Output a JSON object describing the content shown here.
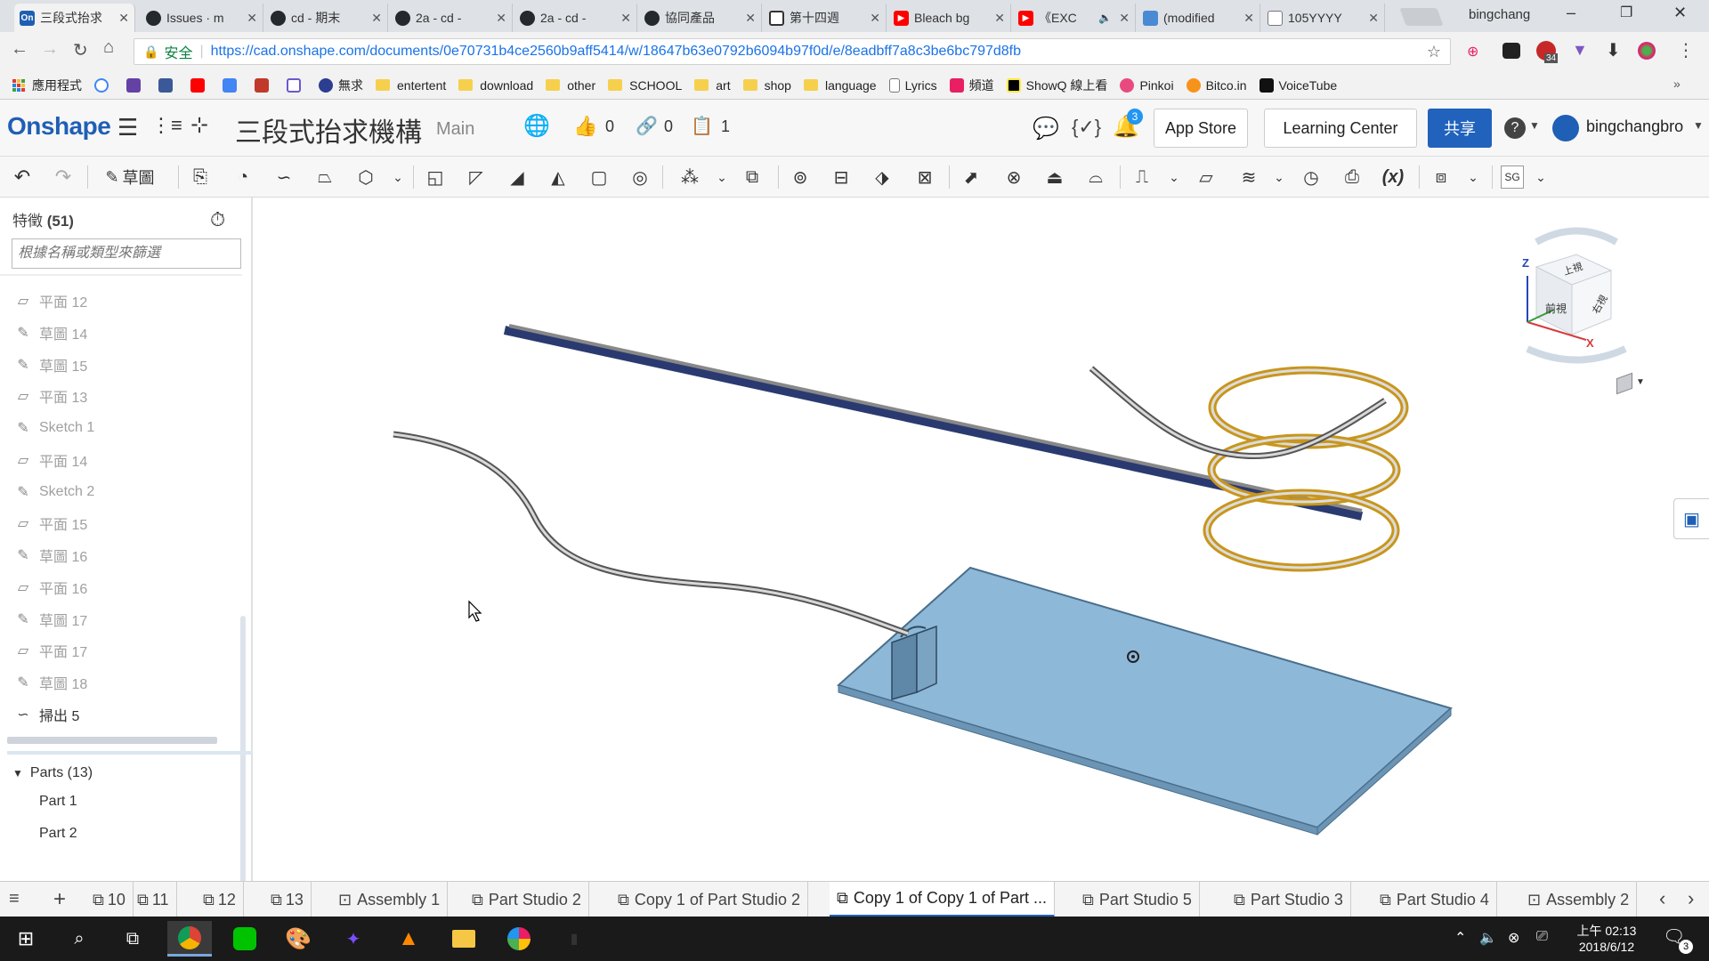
{
  "browser": {
    "tabs": [
      {
        "title": "三段式抬求",
        "active": true,
        "icon": "onshape-favicon"
      },
      {
        "title": "Issues · m",
        "icon": "github-icon"
      },
      {
        "title": "cd - 期末",
        "icon": "github-icon"
      },
      {
        "title": "2a - cd - ",
        "icon": "github-icon"
      },
      {
        "title": "2a - cd - ",
        "icon": "github-icon"
      },
      {
        "title": "協同產品",
        "icon": "github-icon"
      },
      {
        "title": "第十四週",
        "icon": "book-icon"
      },
      {
        "title": "Bleach bg",
        "icon": "youtube-icon"
      },
      {
        "title": "《EXC",
        "icon": "youtube-icon"
      },
      {
        "title": "(modified",
        "icon": "layers-icon"
      },
      {
        "title": "105YYYY",
        "icon": "page-icon"
      }
    ],
    "profile_name": "bingchang",
    "security_label": "安全",
    "url": "https://cad.onshape.com/documents/0e70731b4ce2560b9aff5414/w/18647b63e0792b6094b97f0d/e/8eadbff7a8c3be6bc797d8fb",
    "extension_badge": "34",
    "bookmarks": [
      {
        "label": "應用程式",
        "type": "apps"
      },
      {
        "label": "",
        "type": "google",
        "color": "#4285f4"
      },
      {
        "label": "",
        "type": "twitch",
        "color": "#6441a5"
      },
      {
        "label": "",
        "type": "facebook",
        "color": "#3b5998"
      },
      {
        "label": "",
        "type": "youtube",
        "color": "#ff0000"
      },
      {
        "label": "",
        "type": "translate",
        "color": "#4285f4"
      },
      {
        "label": "",
        "type": "crest",
        "color": "#c0392b"
      },
      {
        "label": "",
        "type": "e-app",
        "color": "#6a5acd"
      },
      {
        "label": "無求",
        "type": "eye",
        "color": "#2c3e8f"
      },
      {
        "label": "entertent",
        "type": "folder"
      },
      {
        "label": "download",
        "type": "folder"
      },
      {
        "label": "other",
        "type": "folder"
      },
      {
        "label": "SCHOOL",
        "type": "folder"
      },
      {
        "label": "art",
        "type": "folder"
      },
      {
        "label": "shop",
        "type": "folder"
      },
      {
        "label": "language",
        "type": "folder"
      },
      {
        "label": "Lyrics",
        "type": "page"
      },
      {
        "label": "頻道",
        "type": "app",
        "color": "#e91e63"
      },
      {
        "label": "ShowQ 線上看",
        "type": "app",
        "color": "#000000"
      },
      {
        "label": "Pinkoi",
        "type": "app",
        "color": "#e84a7f"
      },
      {
        "label": "Bitco.in",
        "type": "app",
        "color": "#f7931a"
      },
      {
        "label": "VoiceTube",
        "type": "app",
        "color": "#111111"
      }
    ]
  },
  "onshape": {
    "logo": "Onshape",
    "doc_title": "三段式抬求機構",
    "branch": "Main",
    "likes": "0",
    "links": "0",
    "copies": "1",
    "notif_count": "3",
    "app_store": "App Store",
    "learning_center": "Learning Center",
    "share": "共享",
    "user": "bingchangbro",
    "accent": "#2162bd"
  },
  "toolbar": {
    "sketch_label": "草圖",
    "sg_label": "SG"
  },
  "feature_panel": {
    "title": "特徵",
    "count": "(51)",
    "filter_placeholder": "根據名稱或類型來篩選",
    "features": [
      {
        "label": "平面 12",
        "kind": "plane"
      },
      {
        "label": "草圖 14",
        "kind": "sketch"
      },
      {
        "label": "草圖 15",
        "kind": "sketch"
      },
      {
        "label": "平面 13",
        "kind": "plane"
      },
      {
        "label": "Sketch 1",
        "kind": "sketch"
      },
      {
        "label": "平面 14",
        "kind": "plane"
      },
      {
        "label": "Sketch 2",
        "kind": "sketch"
      },
      {
        "label": "平面 15",
        "kind": "plane"
      },
      {
        "label": "草圖 16",
        "kind": "sketch"
      },
      {
        "label": "平面 16",
        "kind": "plane"
      },
      {
        "label": "草圖 17",
        "kind": "sketch"
      },
      {
        "label": "平面 17",
        "kind": "plane"
      },
      {
        "label": "草圖 18",
        "kind": "sketch"
      },
      {
        "label": "掃出 5",
        "kind": "sweep"
      }
    ],
    "parts_header": "Parts (13)",
    "parts": [
      "Part 1",
      "Part 2"
    ]
  },
  "viewcube": {
    "top": "上視",
    "front": "前視",
    "right": "右視",
    "axis_x": "X",
    "axis_z": "Z"
  },
  "bottom_tabs": [
    {
      "label": "10"
    },
    {
      "label": "11"
    },
    {
      "label": "12"
    },
    {
      "label": "13"
    },
    {
      "label": "Assembly 1",
      "kind": "assembly"
    },
    {
      "label": "Part Studio 2"
    },
    {
      "label": "Copy 1 of Part Studio 2"
    },
    {
      "label": "Copy 1 of Copy 1 of Part ...",
      "active": true
    },
    {
      "label": "Part Studio 5"
    },
    {
      "label": "Part Studio 3"
    },
    {
      "label": "Part Studio 4"
    },
    {
      "label": "Assembly 2",
      "kind": "assembly"
    }
  ],
  "taskbar": {
    "time": "上午 02:13",
    "date": "2018/6/12",
    "notif_count": "3"
  }
}
